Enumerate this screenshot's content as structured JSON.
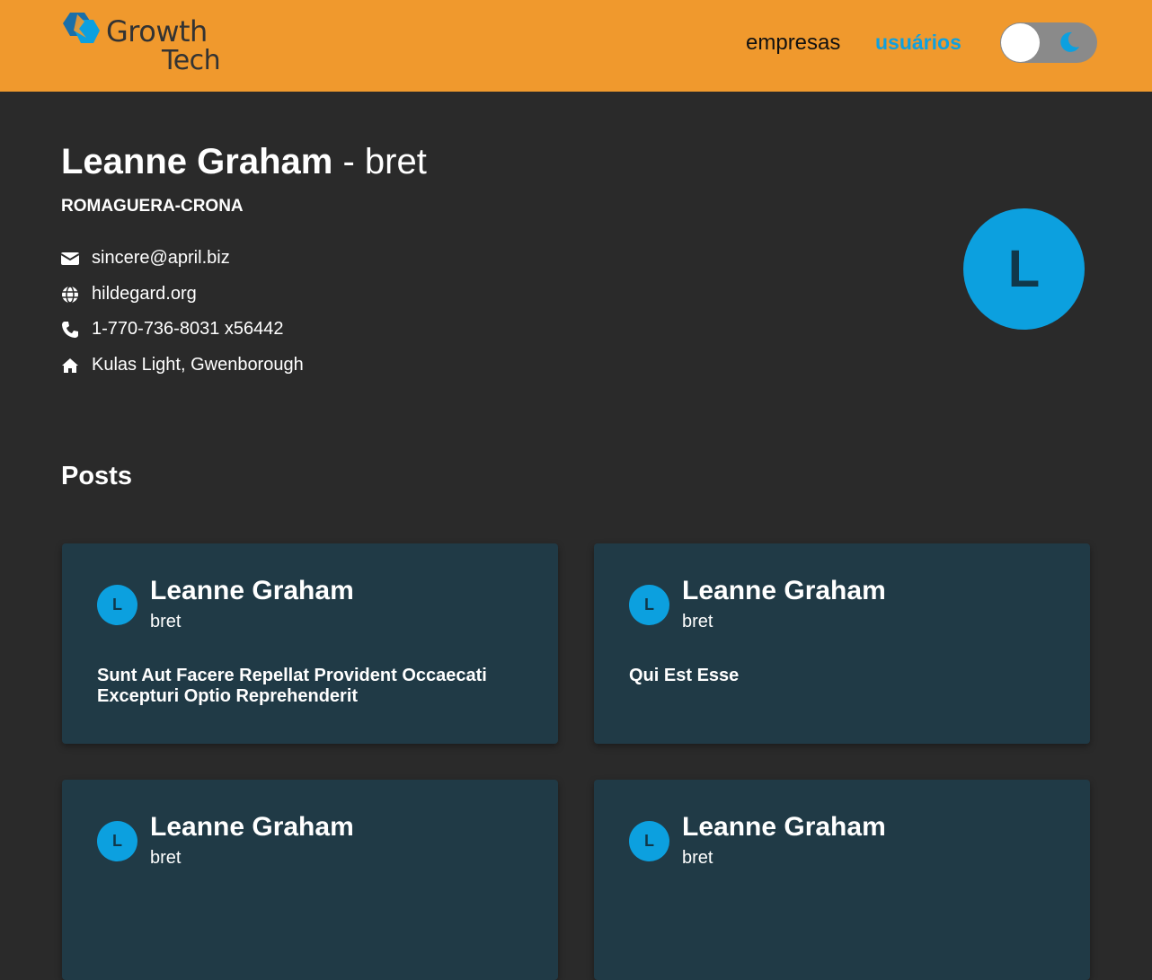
{
  "header": {
    "logo_line1": "Growth",
    "logo_line2": "Tech",
    "nav": [
      {
        "label": "empresas"
      },
      {
        "label": "usuários"
      }
    ],
    "theme_toggle": {
      "mode": "dark",
      "icon": "moon-icon"
    },
    "colors": {
      "background": "#f0992d",
      "active_link": "#0fa0df"
    }
  },
  "profile": {
    "name": "Leanne Graham",
    "separator": "-",
    "username": "bret",
    "company": "ROMAGUERA-CRONA",
    "email": "sincere@april.biz",
    "website": "hildegard.org",
    "phone": "1-770-736-8031 x56442",
    "address": "Kulas Light, Gwenborough",
    "avatar_initial": "L",
    "avatar_color": "#0ca0df"
  },
  "posts_section": {
    "title": "Posts",
    "posts": [
      {
        "author": "Leanne Graham",
        "username": "bret",
        "initial": "L",
        "title": "Sunt Aut Facere Repellat Provident Occaecati Excepturi Optio Reprehenderit"
      },
      {
        "author": "Leanne Graham",
        "username": "bret",
        "initial": "L",
        "title": "Qui Est Esse"
      },
      {
        "author": "Leanne Graham",
        "username": "bret",
        "initial": "L",
        "title": ""
      },
      {
        "author": "Leanne Graham",
        "username": "bret",
        "initial": "L",
        "title": ""
      }
    ]
  }
}
